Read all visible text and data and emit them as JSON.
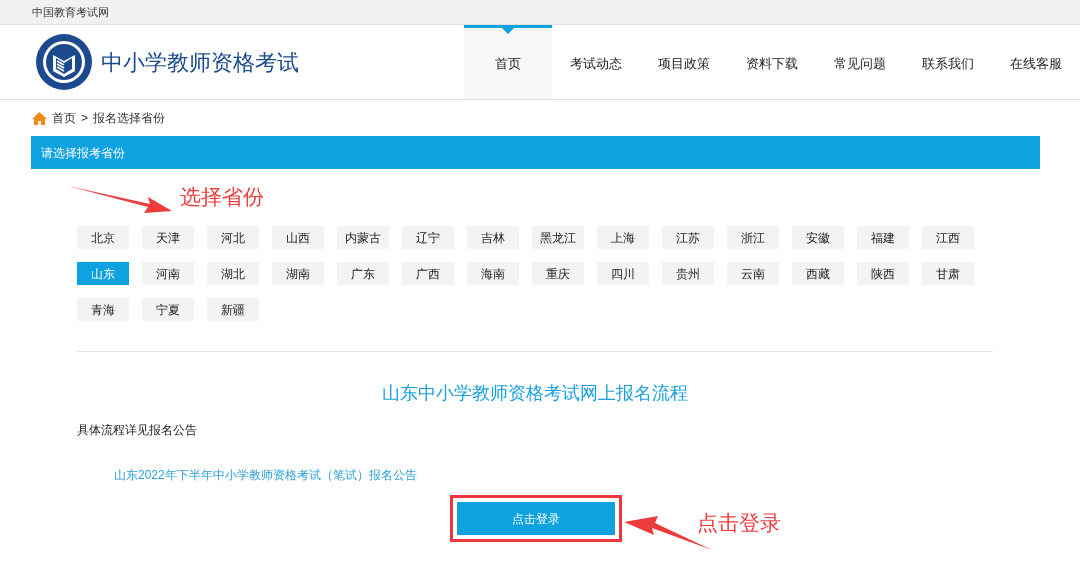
{
  "top_bar": {
    "site_link": "中国教育考试网"
  },
  "header": {
    "title": "中小学教师资格考试",
    "nav": [
      {
        "label": "首页",
        "selected": true
      },
      {
        "label": "考试动态",
        "selected": false
      },
      {
        "label": "项目政策",
        "selected": false
      },
      {
        "label": "资料下载",
        "selected": false
      },
      {
        "label": "常见问题",
        "selected": false
      },
      {
        "label": "联系我们",
        "selected": false
      },
      {
        "label": "在线客服",
        "selected": false
      }
    ]
  },
  "breadcrumb": [
    "首页",
    ">",
    "报名选择省份"
  ],
  "panel_title": "请选择报考省份",
  "provinces": [
    {
      "label": "北京",
      "selected": false
    },
    {
      "label": "天津",
      "selected": false
    },
    {
      "label": "河北",
      "selected": false
    },
    {
      "label": "山西",
      "selected": false
    },
    {
      "label": "内蒙古",
      "selected": false
    },
    {
      "label": "辽宁",
      "selected": false
    },
    {
      "label": "吉林",
      "selected": false
    },
    {
      "label": "黑龙江",
      "selected": false
    },
    {
      "label": "上海",
      "selected": false
    },
    {
      "label": "江苏",
      "selected": false
    },
    {
      "label": "浙江",
      "selected": false
    },
    {
      "label": "安徽",
      "selected": false
    },
    {
      "label": "福建",
      "selected": false
    },
    {
      "label": "江西",
      "selected": false
    },
    {
      "label": "山东",
      "selected": true
    },
    {
      "label": "河南",
      "selected": false
    },
    {
      "label": "湖北",
      "selected": false
    },
    {
      "label": "湖南",
      "selected": false
    },
    {
      "label": "广东",
      "selected": false
    },
    {
      "label": "广西",
      "selected": false
    },
    {
      "label": "海南",
      "selected": false
    },
    {
      "label": "重庆",
      "selected": false
    },
    {
      "label": "四川",
      "selected": false
    },
    {
      "label": "贵州",
      "selected": false
    },
    {
      "label": "云南",
      "selected": false
    },
    {
      "label": "西藏",
      "selected": false
    },
    {
      "label": "陕西",
      "selected": false
    },
    {
      "label": "甘肃",
      "selected": false
    },
    {
      "label": "青海",
      "selected": false
    },
    {
      "label": "宁夏",
      "selected": false
    },
    {
      "label": "新疆",
      "selected": false
    }
  ],
  "process": {
    "title": "山东中小学教师资格考试网上报名流程",
    "note": "具体流程详见报名公告",
    "link": "山东2022年下半年中小学教师资格考试（笔试）报名公告",
    "button": "点击登录"
  },
  "annotations": [
    {
      "text": "选择省份"
    },
    {
      "text": "点击登录"
    }
  ]
}
